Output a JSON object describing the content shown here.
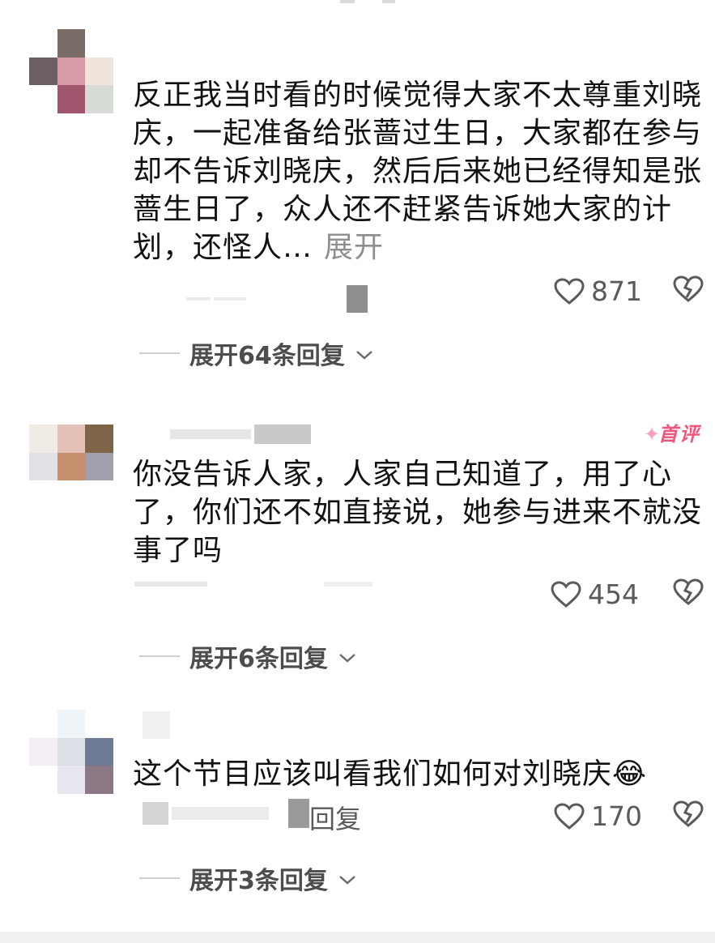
{
  "comments": [
    {
      "text": "反正我当时看的时候觉得大家不太尊重刘晓庆，一起准备给张蔷过生日，大家都在参与却不告诉刘晓庆，然后后来她已经得知是张蔷生日了，众人还不赶紧告诉她大家的计划，还怪人…",
      "expand_label": "展开",
      "likes": "871",
      "replies_label": "展开64条回复",
      "badge": ""
    },
    {
      "text": "你没告诉人家，人家自己知道了，用了心了，你们还不如直接说，她参与进来不就没事了吗",
      "expand_label": "",
      "likes": "454",
      "replies_label": "展开6条回复",
      "badge": "首评"
    },
    {
      "text": "这个节目应该叫看我们如何对刘晓庆😂",
      "expand_label": "",
      "likes": "170",
      "replies_label": "展开3条回复",
      "badge": "",
      "reply_link": "回复"
    }
  ],
  "icons": {
    "like": "heart-outline-icon",
    "dislike": "broken-heart-icon",
    "chevron": "chevron-down-icon"
  },
  "colors": {
    "badge": "#f2557b",
    "muted_text": "#8e8e8e",
    "count_text": "#5a5a5a"
  }
}
